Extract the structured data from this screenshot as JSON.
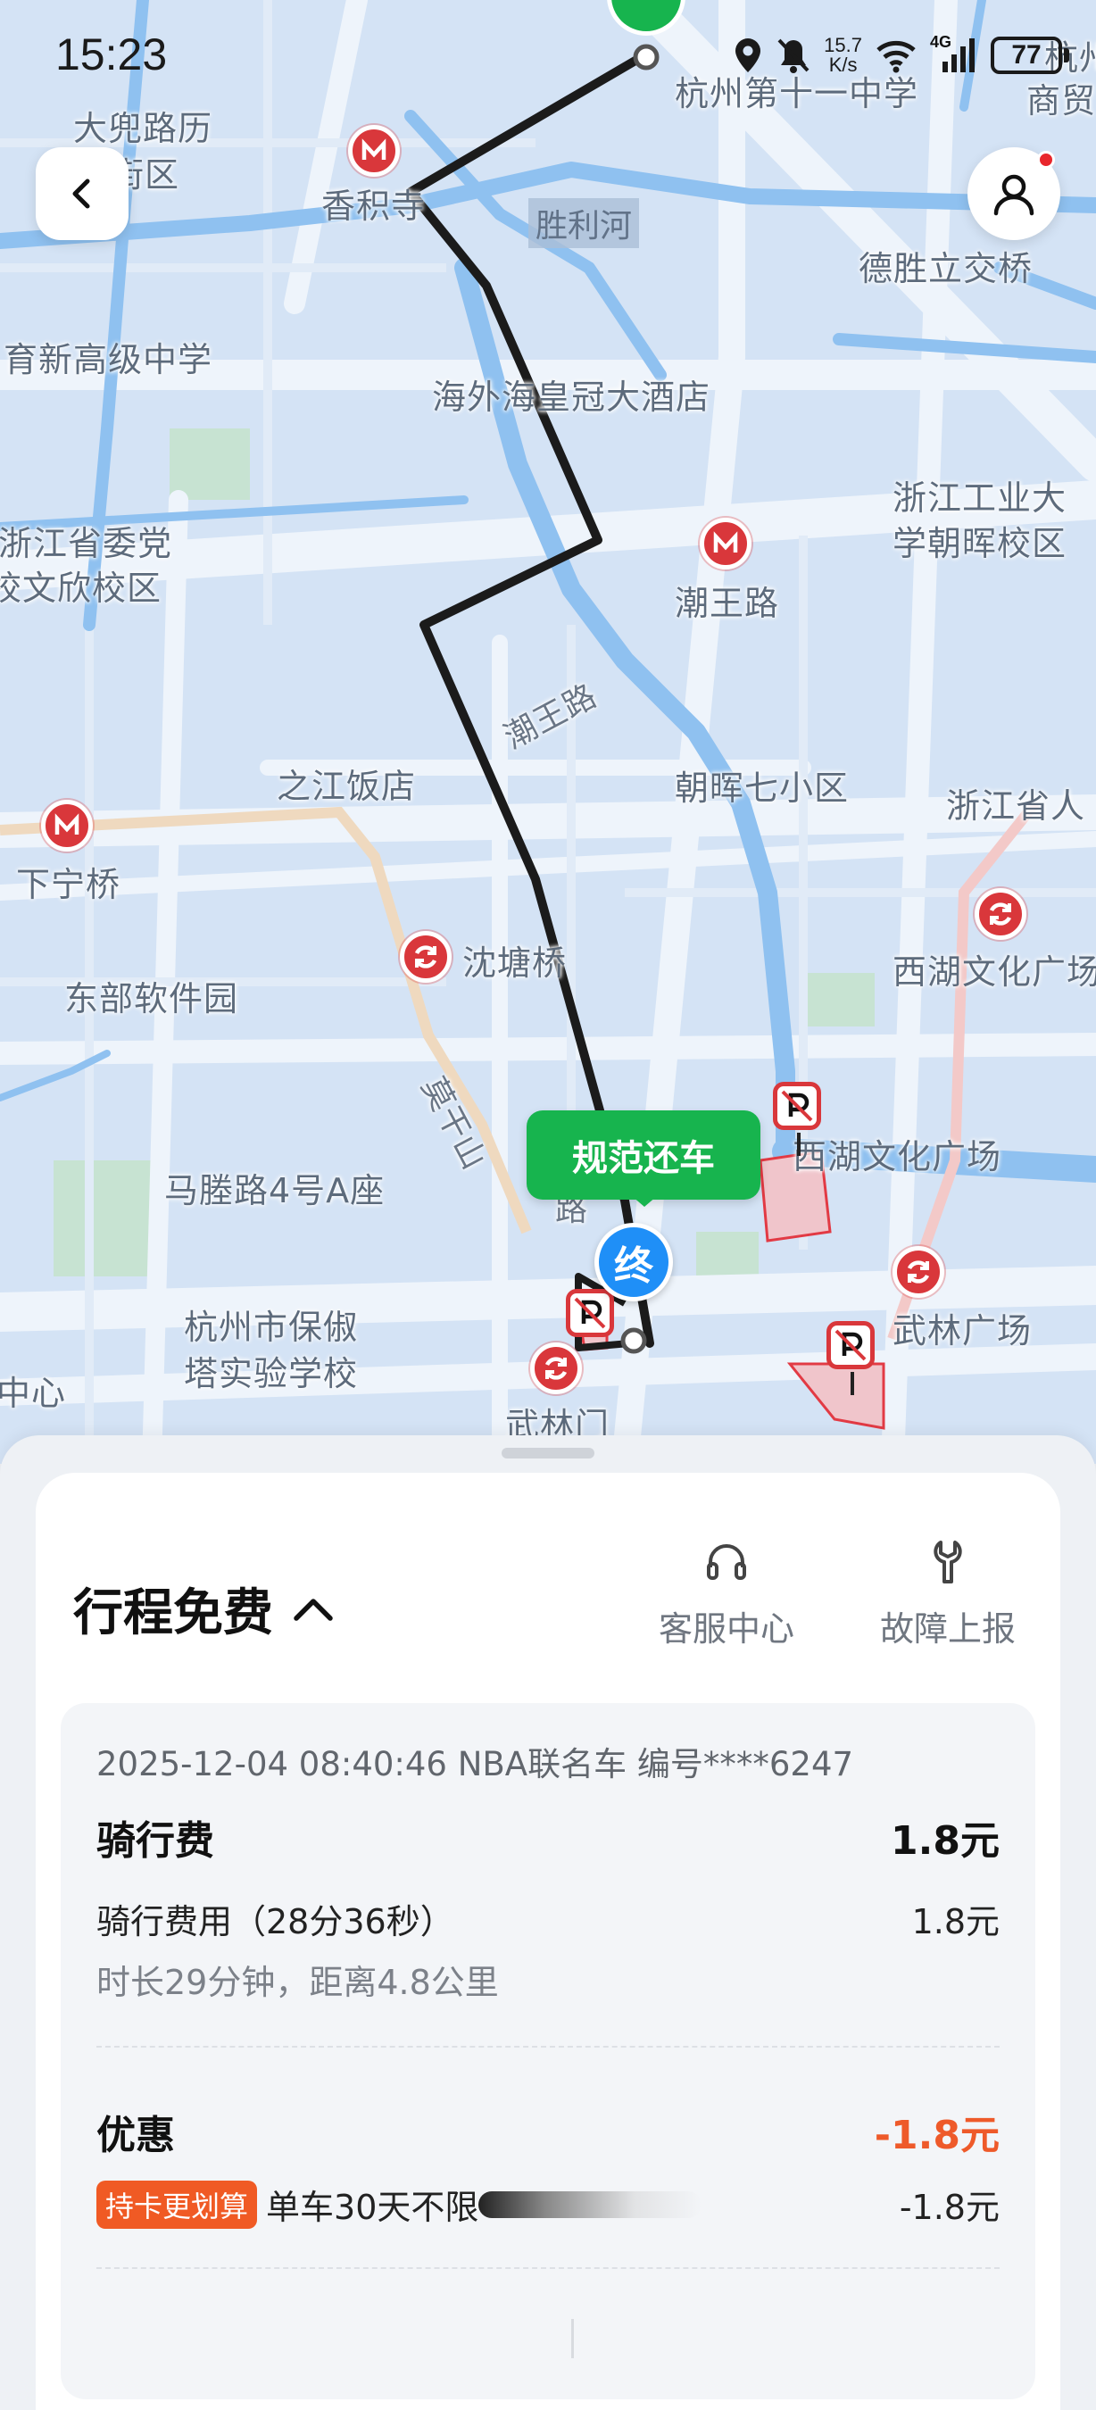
{
  "status_bar": {
    "time": "15:23",
    "net_speed_value": "15.7",
    "net_speed_unit": "K/s",
    "network": "4G",
    "battery": "77",
    "icons": [
      "location-icon",
      "mute-icon",
      "wifi-icon",
      "signal-icon",
      "battery-icon"
    ]
  },
  "map": {
    "labels": {
      "l1": "大兜路历",
      "l2": "史街区",
      "l3": "香积寺",
      "l4": "胜利河",
      "l5": "杭州第十一中学",
      "l6": "杭州",
      "l7": "商贸",
      "l8": "德胜立交桥",
      "l9": "育新高级中学",
      "l10": "海外海皇冠大酒店",
      "l11": "浙江工业大",
      "l12": "学朝晖校区",
      "l13": "浙江省委党",
      "l14": "校文欣校区",
      "l15": "潮王路",
      "l16": "潮王路",
      "l17": "之江饭店",
      "l18": "朝晖七小区",
      "l19": "浙江省人",
      "l20": "下宁桥",
      "l21": "沈塘桥",
      "l22": "西湖文化广场",
      "l23": "东部软件园",
      "l24": "西湖文化广场",
      "l25": "马塍路4号A座",
      "l26": "莫干山",
      "l27": "路",
      "l28": "杭州市保俶",
      "l29": "塔实验学校",
      "l30": "武林广场",
      "l31": "武林门",
      "l32": "中心"
    },
    "return_tag": "规范还车",
    "end_marker": "终",
    "colors": {
      "water": "#8fc1f0",
      "land": "#d4e3f5",
      "road": "#eef4fb",
      "route": "#1b1b1b",
      "brand_green": "#17b44e",
      "end_blue": "#1f8ff7",
      "metro_red": "#d9373b"
    }
  },
  "nav": {
    "back_icon": "chevron-left-icon",
    "profile_icon": "user-icon"
  },
  "sheet": {
    "title": "行程免费",
    "title_icon": "chevron-up-icon",
    "actions": {
      "service": {
        "label": "客服中心",
        "icon": "headset-icon"
      },
      "fault": {
        "label": "故障上报",
        "icon": "wrench-icon"
      }
    },
    "detail": {
      "meta": "2025-12-04 08:40:46 NBA联名车 编号****6247",
      "ride_fee": {
        "title": "骑行费",
        "amount": "1.8元",
        "item_label": "骑行费用（28分36秒）",
        "item_amount": "1.8元",
        "sub": "时长29分钟，距离4.8公里"
      },
      "discount": {
        "title": "优惠",
        "amount": "-1.8元",
        "badge": "持卡更划算",
        "item_label": "单车30天不限",
        "item_amount": "-1.8元"
      }
    }
  }
}
